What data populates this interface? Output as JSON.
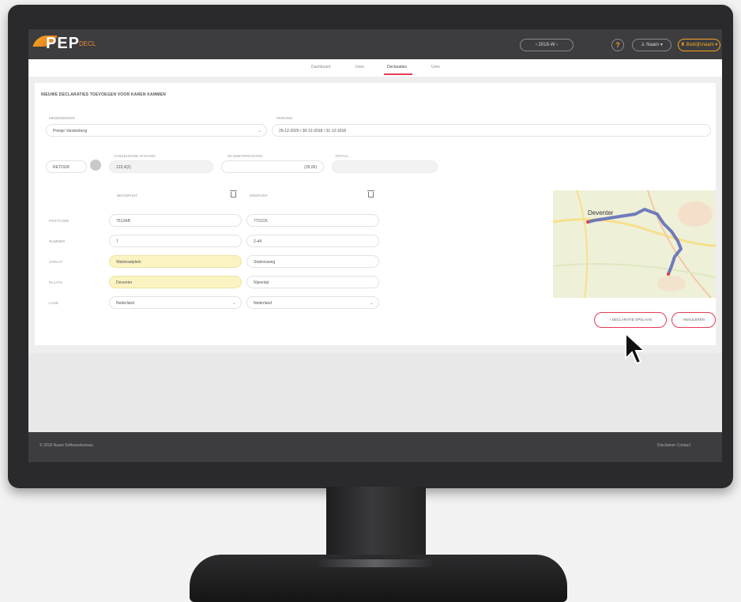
{
  "header": {
    "logo_text": "PEP",
    "logo_suffix": "DECL",
    "week_selector": "‹   2018-W   ›",
    "help_label": "?",
    "user_menu": "♙ Naam ▾",
    "org_menu": "♜ Bedrijfsnaam ▾"
  },
  "tabs": [
    {
      "label": "Dashboard"
    },
    {
      "label": "Uren"
    },
    {
      "label": "Declaraties"
    },
    {
      "label": "Uren"
    }
  ],
  "form": {
    "title": "NIEUWE DECLARATIES TOEVOEGEN VOOR KAREN KAMMEN",
    "medewerker_label": "MEDEWERKER",
    "medewerker_value": "Pietsje Vandenberg",
    "periode_label": "PERIODE",
    "periode_value": "29-12-2020 / 30-12-2018 / 31-12-2018",
    "retour_label": "RETOUR",
    "afstand_label": "AANGELEGDE AFSTAND",
    "afstand_value": "123,4(2)",
    "kosten_label": "KILOMETERKOSTEN",
    "kosten_value": "(35,00)",
    "totaal_label": "TOTAAL",
    "col1_label": "BEGINPUNT",
    "col2_label": "EINDPUNT",
    "rows": [
      {
        "label": "POSTCODE",
        "v1": "7512AB",
        "v2": "7711CK"
      },
      {
        "label": "NUMMER",
        "v1": "7",
        "v2": "2-44"
      },
      {
        "label": "STRAAT",
        "v1": "Walstraatplein",
        "v2": "Stationsweg"
      },
      {
        "label": "PLAATS",
        "v1": "Deventer",
        "v2": "Nijverdal"
      },
      {
        "label": "LAND",
        "v1": "Nederland",
        "v2": "Nederland"
      }
    ],
    "map_label": "Deventer",
    "save_button": "+ DECLARATIE OPSLAAN",
    "cancel_button": "ANNULEREN"
  },
  "footer": {
    "copyright": "© 2018 Naam Softwarebureau",
    "links": "Disclaimer   Contact"
  },
  "colors": {
    "accent": "#e33c55",
    "brand_orange": "#f5a623",
    "header_bg": "#3d3d3f",
    "highlight_yellow": "#fbf3c2"
  }
}
